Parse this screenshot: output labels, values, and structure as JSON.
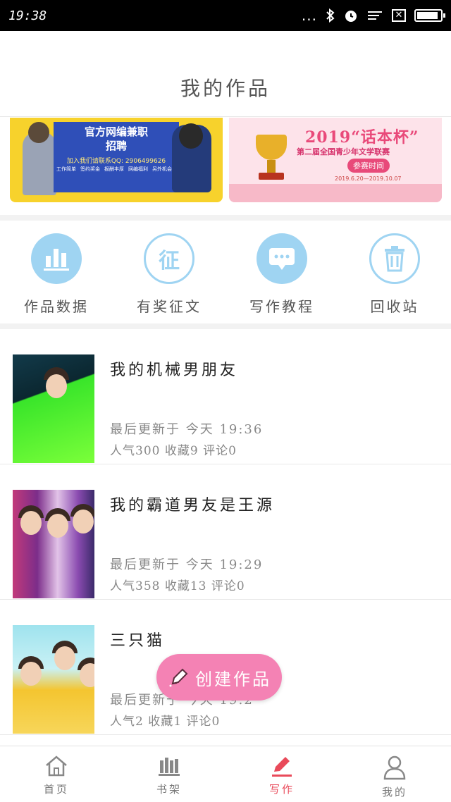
{
  "status_bar": {
    "time": "19:38",
    "dots": "...",
    "battery_level": 0.9,
    "icons": [
      "bluetooth-icon",
      "alarm-icon",
      "signal-icon",
      "close-box-icon",
      "battery-icon"
    ]
  },
  "header": {
    "title": "我的作品"
  },
  "banners": {
    "left": {
      "title_line1": "官方网编兼职",
      "title_line2": "招聘",
      "qq": "加入我们请联系QQ: 2906499626",
      "tags": [
        "工作简单",
        "签约奖金",
        "报酬丰厚",
        "网编福利",
        "另外机会"
      ]
    },
    "right": {
      "year": "2019“话本杯”",
      "subtitle": "第二届全国青少年文学联赛",
      "button": "参赛时间",
      "dates": "2019.6.20—2019.10.07"
    }
  },
  "quick_actions": [
    {
      "label": "作品数据",
      "icon": "chart-bars-icon"
    },
    {
      "label": "有奖征文",
      "icon": "contest-icon",
      "glyph": "征"
    },
    {
      "label": "写作教程",
      "icon": "chat-bubble-icon"
    },
    {
      "label": "回收站",
      "icon": "trash-icon"
    }
  ],
  "works": [
    {
      "title": "我的机械男朋友",
      "updated": "最后更新于 今天 19:36",
      "stats": "人气300 收藏9 评论0"
    },
    {
      "title": "我的霸道男友是王源",
      "updated": "最后更新于 今天 19:29",
      "stats": "人气358 收藏13 评论0"
    },
    {
      "title": "三只猫",
      "updated": "最后更新于 今天 19:2",
      "stats": "人气2 收藏1 评论0"
    }
  ],
  "fab": {
    "label": "创建作品"
  },
  "tabs": [
    {
      "label": "首页",
      "icon": "home-icon",
      "active": false
    },
    {
      "label": "书架",
      "icon": "bookshelf-icon",
      "active": false
    },
    {
      "label": "写作",
      "icon": "pen-icon",
      "active": true
    },
    {
      "label": "我的",
      "icon": "user-icon",
      "active": false
    }
  ],
  "colors": {
    "accent": "#f482b4",
    "icon_blue": "#9fd4f2",
    "active_tab": "#e94a5a"
  }
}
